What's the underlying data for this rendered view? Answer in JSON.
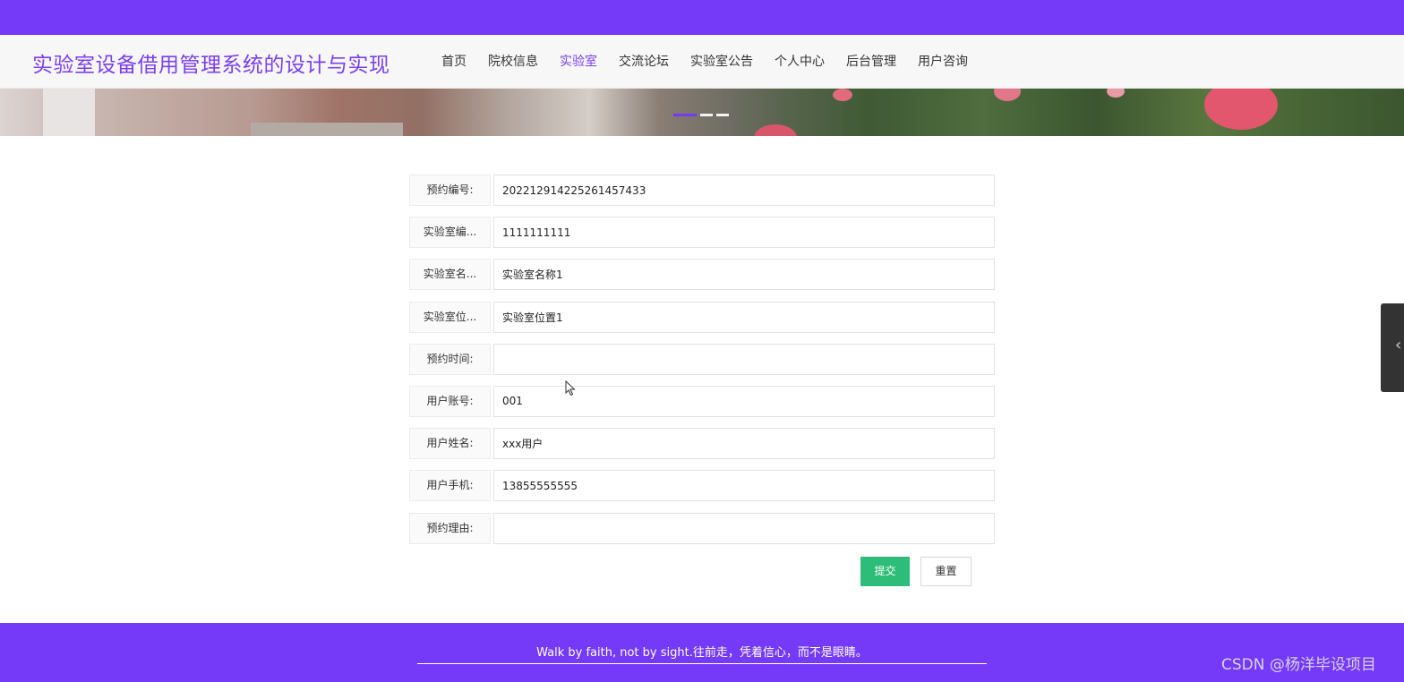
{
  "site": {
    "title": "实验室设备借用管理系统的设计与实现"
  },
  "nav": {
    "items": [
      {
        "label": "首页",
        "active": false
      },
      {
        "label": "院校信息",
        "active": false
      },
      {
        "label": "实验室",
        "active": true
      },
      {
        "label": "交流论坛",
        "active": false
      },
      {
        "label": "实验室公告",
        "active": false
      },
      {
        "label": "个人中心",
        "active": false
      },
      {
        "label": "后台管理",
        "active": false
      },
      {
        "label": "用户咨询",
        "active": false
      }
    ]
  },
  "form": {
    "fields": [
      {
        "label": "预约编号:",
        "value": "20221291422526145743​3"
      },
      {
        "label": "实验室编...",
        "value": "1111111111"
      },
      {
        "label": "实验室名...",
        "value": "实验室名称1"
      },
      {
        "label": "实验室位...",
        "value": "实验室位置1"
      },
      {
        "label": "预约时间:",
        "value": ""
      },
      {
        "label": "用户账号:",
        "value": "001"
      },
      {
        "label": "用户姓名:",
        "value": "xxx用户"
      },
      {
        "label": "用户手机:",
        "value": "13855555555"
      },
      {
        "label": "预约理由:",
        "value": ""
      }
    ],
    "submit_label": "提交",
    "reset_label": "重置"
  },
  "footer": {
    "text": "Walk by faith, not by sight.往前走，凭着信心，而不是眼睛。",
    "watermark": "CSDN @杨洋毕设项目"
  },
  "colors": {
    "brand": "#7539f8",
    "title": "#7a3ff6",
    "submit": "#2dbd78"
  },
  "icons": {
    "side_tab": "chevron-left-icon",
    "cursor": "mouse-pointer-icon"
  }
}
